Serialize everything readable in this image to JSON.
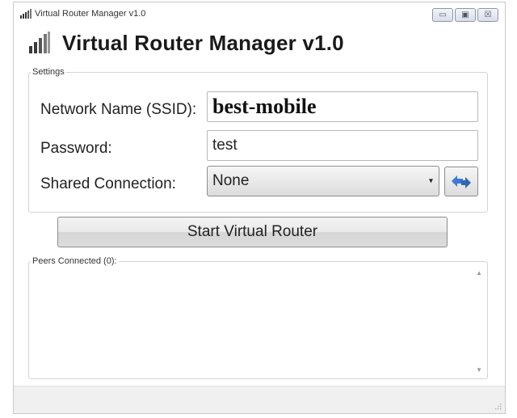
{
  "window": {
    "title": "Virtual Router Manager v1.0",
    "controls": {
      "minimize": "▭",
      "maximize": "▣",
      "close": "☒"
    }
  },
  "header": {
    "title": "Virtual Router Manager v1.0",
    "icon": "signal-bars-icon"
  },
  "settings": {
    "legend": "Settings",
    "ssid": {
      "label": "Network Name (SSID):",
      "value": "best-mobile"
    },
    "password": {
      "label": "Password:",
      "value": "test"
    },
    "shared_connection": {
      "label": "Shared Connection:",
      "selected": "None",
      "arrow": "▾"
    },
    "refresh_icon": "refresh-arrows-icon"
  },
  "start_button": {
    "label": "Start Virtual Router"
  },
  "peers": {
    "legend": "Peers Connected (0):",
    "scroll_up": "▲",
    "scroll_down": "▼"
  },
  "colors": {
    "accent_blue": "#3a7bd5",
    "border": "#b8b8b8",
    "statusbar": "#f0f0f0"
  }
}
